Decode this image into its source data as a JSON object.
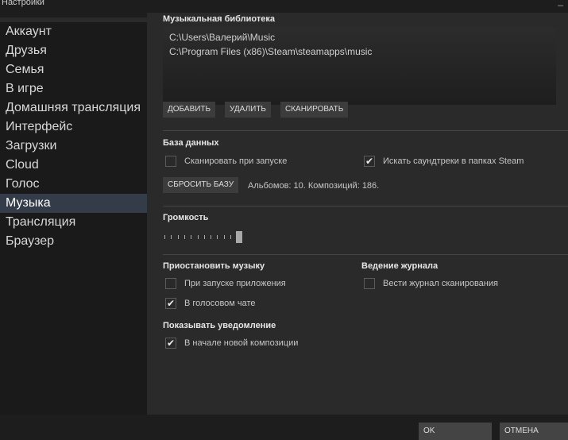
{
  "window": {
    "title": "Настройки",
    "minimize": "_"
  },
  "sidebar": {
    "items": [
      {
        "label": "Аккаунт"
      },
      {
        "label": "Друзья"
      },
      {
        "label": "Семья"
      },
      {
        "label": "В игре"
      },
      {
        "label": "Домашняя трансляция"
      },
      {
        "label": "Интерфейс"
      },
      {
        "label": "Загрузки"
      },
      {
        "label": "Cloud"
      },
      {
        "label": "Голос"
      },
      {
        "label": "Музыка",
        "selected": true
      },
      {
        "label": "Трансляция"
      },
      {
        "label": "Браузер"
      }
    ]
  },
  "library": {
    "title": "Музыкальная библиотека",
    "paths": [
      "C:\\Users\\Валерий\\Music",
      "C:\\Program Files (x86)\\Steam\\steamapps\\music"
    ],
    "add": "ДОБАВИТЬ",
    "remove": "УДАЛИТЬ",
    "scan": "СКАНИРОВАТЬ"
  },
  "database": {
    "title": "База данных",
    "scan_on_start": {
      "label": "Сканировать при запуске",
      "checked": false
    },
    "search_soundtracks": {
      "label": "Искать саундтреки в папках Steam",
      "checked": true
    },
    "reset": "СБРОСИТЬ БАЗУ",
    "stats": "Альбомов: 10. Композиций: 186."
  },
  "volume": {
    "title": "Громкость",
    "value_percent": 100
  },
  "pause": {
    "title": "Приостановить музыку",
    "on_app_launch": {
      "label": "При запуске приложения",
      "checked": false
    },
    "in_voice_chat": {
      "label": "В голосовом чате",
      "checked": true
    }
  },
  "logging": {
    "title": "Ведение журнала",
    "scan_log": {
      "label": "Вести журнал сканирования",
      "checked": false
    }
  },
  "notify": {
    "title": "Показывать уведомление",
    "new_track": {
      "label": "В начале новой композиции",
      "checked": true
    }
  },
  "footer": {
    "ok": "OK",
    "cancel": "ОТМЕНА"
  },
  "check_glyph": "✔"
}
